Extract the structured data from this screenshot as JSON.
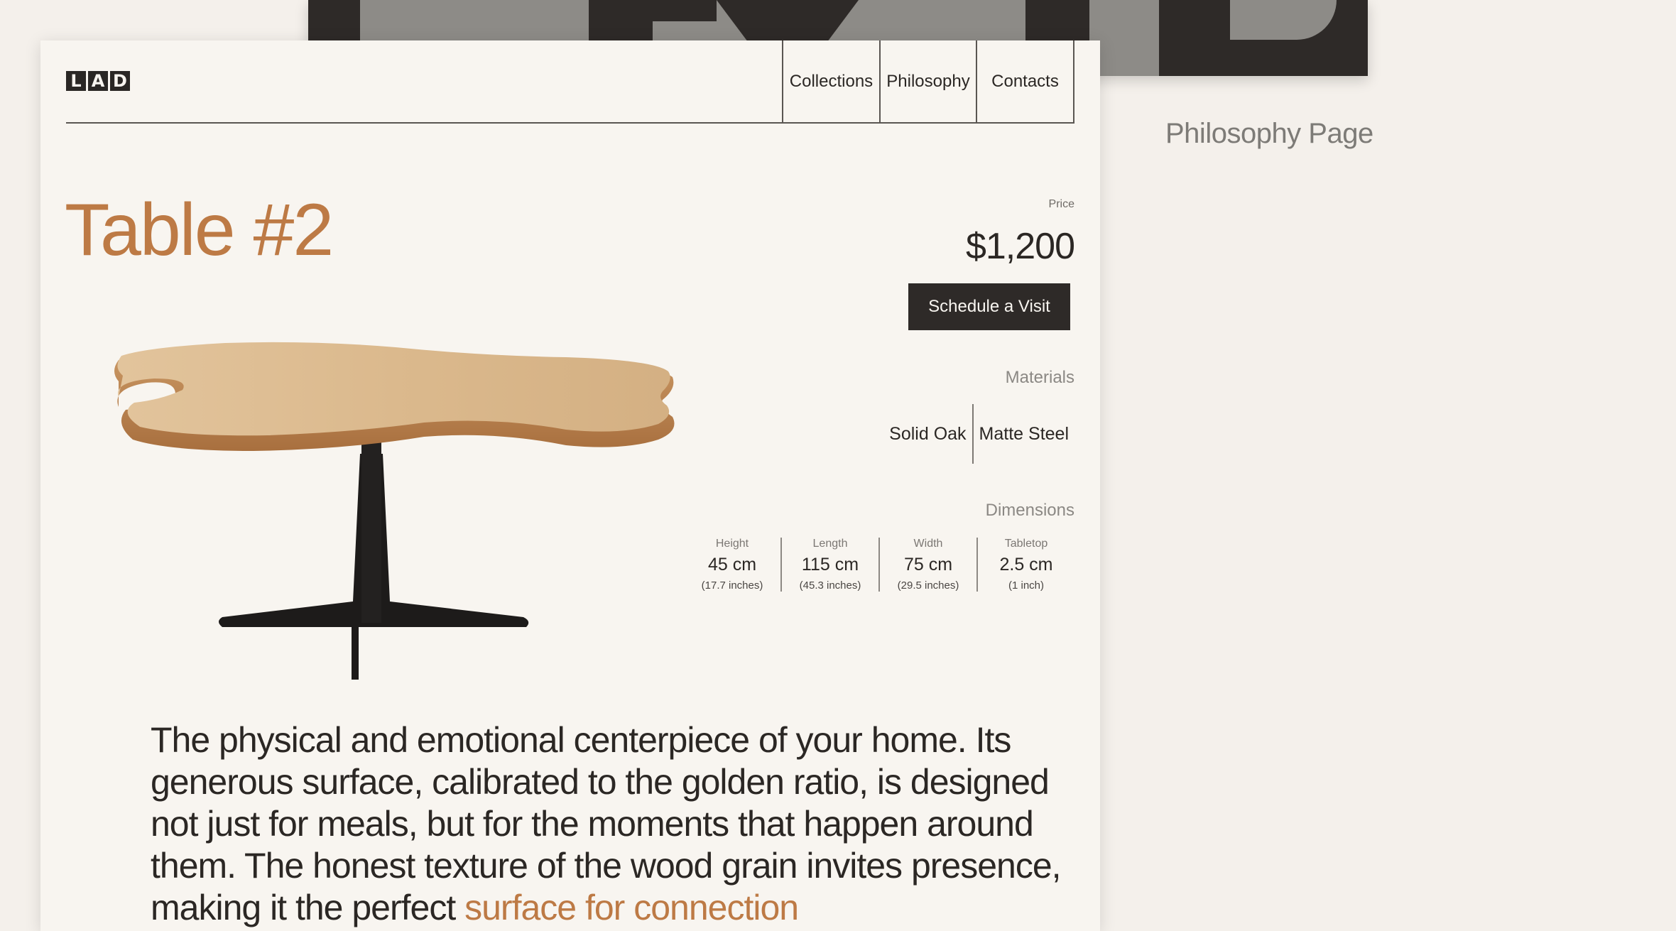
{
  "background_page": {
    "caption": "Philosophy Page"
  },
  "brand": {
    "logo_letters": [
      "L",
      "A",
      "D"
    ]
  },
  "nav": {
    "items": [
      {
        "label": "Collections"
      },
      {
        "label": "Philosophy"
      },
      {
        "label": "Contacts"
      }
    ]
  },
  "product": {
    "title": "Table #2",
    "price_label": "Price",
    "price": "$1,200",
    "cta_label": "Schedule a Visit",
    "materials_label": "Materials",
    "materials": [
      "Solid Oak",
      "Matte Steel"
    ],
    "dimensions_label": "Dimensions",
    "dimensions": [
      {
        "label": "Height",
        "value": "45 cm",
        "sub": "(17.7 inches)"
      },
      {
        "label": "Length",
        "value": "115 cm",
        "sub": "(45.3 inches)"
      },
      {
        "label": "Width",
        "value": "75 cm",
        "sub": "(29.5 inches)"
      },
      {
        "label": "Tabletop",
        "value": "2.5 cm",
        "sub": "(1 inch)"
      }
    ],
    "description": "The physical and emotional centerpiece of your home. Its generous surface, calibrated to the golden ratio, is designed not just for meals, but for the moments that happen around them. The honest texture of the wood grain invites presence, making it the perfect ",
    "description_accent": "surface for connection"
  },
  "colors": {
    "accent": "#bd7a45",
    "dark": "#2e2a28",
    "page_bg": "#f8f5f0"
  }
}
